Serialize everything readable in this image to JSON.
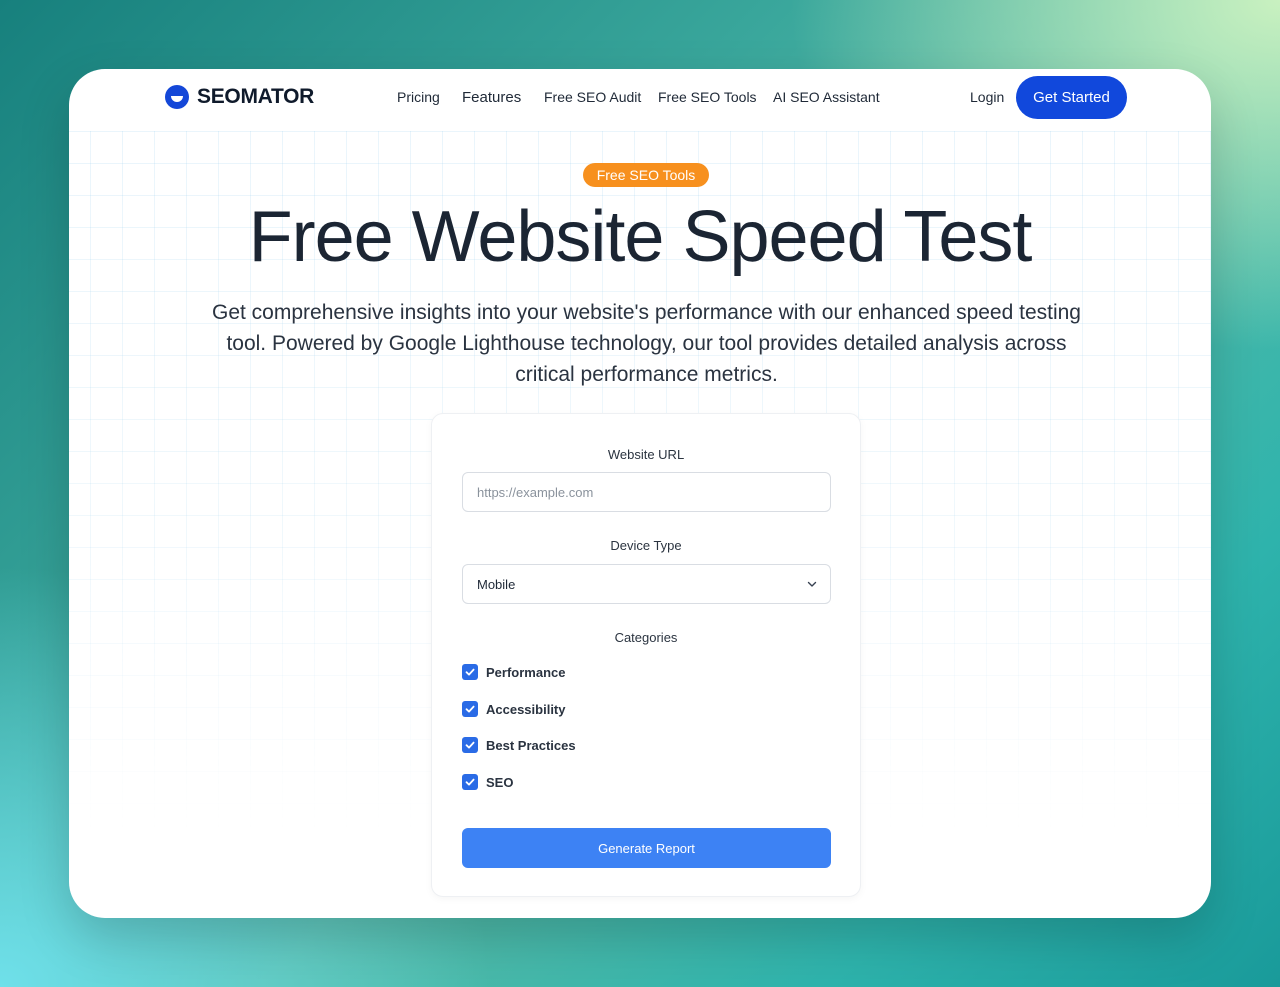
{
  "brand": {
    "name": "SEOMATOR"
  },
  "nav": {
    "links": [
      {
        "label": "Pricing"
      },
      {
        "label": "Features"
      },
      {
        "label": "Free SEO Audit"
      },
      {
        "label": "Free SEO Tools"
      },
      {
        "label": "AI SEO Assistant"
      }
    ],
    "login": "Login",
    "cta": "Get Started"
  },
  "hero": {
    "badge": "Free SEO Tools",
    "title": "Free Website Speed Test",
    "subtitle": "Get comprehensive insights into your website's performance with our enhanced speed testing tool. Powered by Google Lighthouse technology, our tool provides detailed analysis across critical performance metrics."
  },
  "form": {
    "url_label": "Website URL",
    "url_placeholder": "https://example.com",
    "url_value": "",
    "device_label": "Device Type",
    "device_value": "Mobile",
    "categories_label": "Categories",
    "categories": [
      {
        "label": "Performance",
        "checked": true
      },
      {
        "label": "Accessibility",
        "checked": true
      },
      {
        "label": "Best Practices",
        "checked": true
      },
      {
        "label": "SEO",
        "checked": true
      }
    ],
    "submit": "Generate Report"
  },
  "colors": {
    "brand_blue": "#1148dc",
    "badge_orange": "#f7901e",
    "submit_blue": "#3d82f4",
    "checkbox_blue": "#2a6be6"
  }
}
